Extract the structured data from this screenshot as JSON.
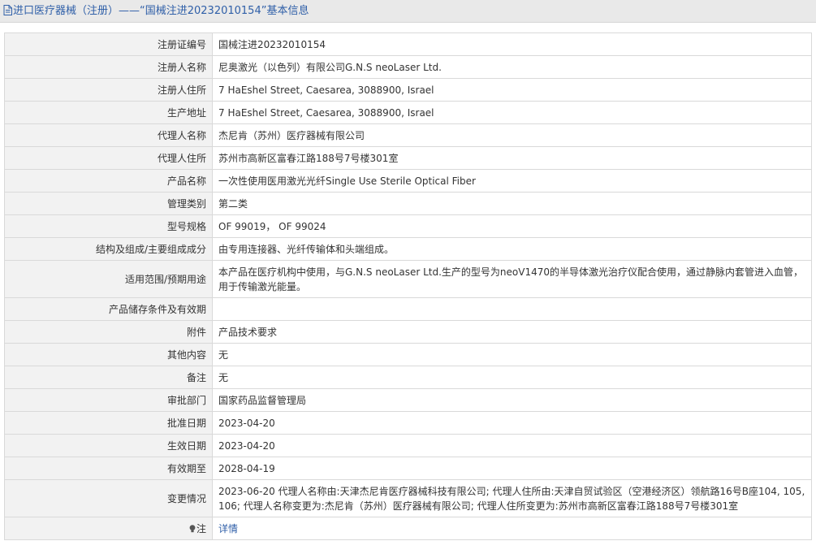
{
  "header": {
    "title": "进口医疗器械（注册）——“国械注进20232010154”基本信息",
    "icon": "document-icon",
    "title_color": "#2f5fa8"
  },
  "fields": [
    {
      "name": "field-registration-number",
      "label": "注册证编号",
      "value": "国械注进20232010154"
    },
    {
      "name": "field-registrant-name",
      "label": "注册人名称",
      "value": "尼奥激光（以色列）有限公司G.N.S neoLaser Ltd."
    },
    {
      "name": "field-registrant-address",
      "label": "注册人住所",
      "value": "7 HaEshel Street, Caesarea, 3088900, Israel"
    },
    {
      "name": "field-production-address",
      "label": "生产地址",
      "value": "7 HaEshel Street, Caesarea, 3088900, Israel"
    },
    {
      "name": "field-agent-name",
      "label": "代理人名称",
      "value": "杰尼肯（苏州）医疗器械有限公司"
    },
    {
      "name": "field-agent-address",
      "label": "代理人住所",
      "value": "苏州市高新区富春江路188号7号楼301室"
    },
    {
      "name": "field-product-name",
      "label": "产品名称",
      "value": "一次性使用医用激光光纤Single Use Sterile Optical Fiber"
    },
    {
      "name": "field-management-category",
      "label": "管理类别",
      "value": "第二类"
    },
    {
      "name": "field-model-spec",
      "label": "型号规格",
      "value": "OF 99019， OF 99024"
    },
    {
      "name": "field-structure",
      "label": "结构及组成/主要组成成分",
      "value": "由专用连接器、光纤传输体和头端组成。"
    },
    {
      "name": "field-intended-use",
      "label": "适用范围/预期用途",
      "value": "本产品在医疗机构中使用，与G.N.S neoLaser Ltd.生产的型号为neoV1470的半导体激光治疗仪配合使用，通过静脉内套管进入血管，用于传输激光能量。",
      "tall": true
    },
    {
      "name": "field-storage",
      "label": "产品储存条件及有效期",
      "value": ""
    },
    {
      "name": "field-attachment",
      "label": "附件",
      "value": "产品技术要求"
    },
    {
      "name": "field-other",
      "label": "其他内容",
      "value": "无"
    },
    {
      "name": "field-remarks",
      "label": "备注",
      "value": "无"
    },
    {
      "name": "field-approval-dept",
      "label": "审批部门",
      "value": "国家药品监督管理局"
    },
    {
      "name": "field-approval-date",
      "label": "批准日期",
      "value": "2023-04-20"
    },
    {
      "name": "field-effective-date",
      "label": "生效日期",
      "value": "2023-04-20"
    },
    {
      "name": "field-expiry-date",
      "label": "有效期至",
      "value": "2028-04-19"
    },
    {
      "name": "field-changes",
      "label": "变更情况",
      "value": "2023-06-20 代理人名称由:天津杰尼肯医疗器械科技有限公司; 代理人住所由:天津自贸试验区（空港经济区）领航路16号B座104, 105, 106; 代理人名称变更为:杰尼肯（苏州）医疗器械有限公司; 代理人住所变更为:苏州市高新区富春江路188号7号楼301室",
      "tall": true
    }
  ],
  "note": {
    "label": "注",
    "icon": "lightbulb-icon",
    "link_text": "详情",
    "link_color": "#2f5fa8"
  }
}
